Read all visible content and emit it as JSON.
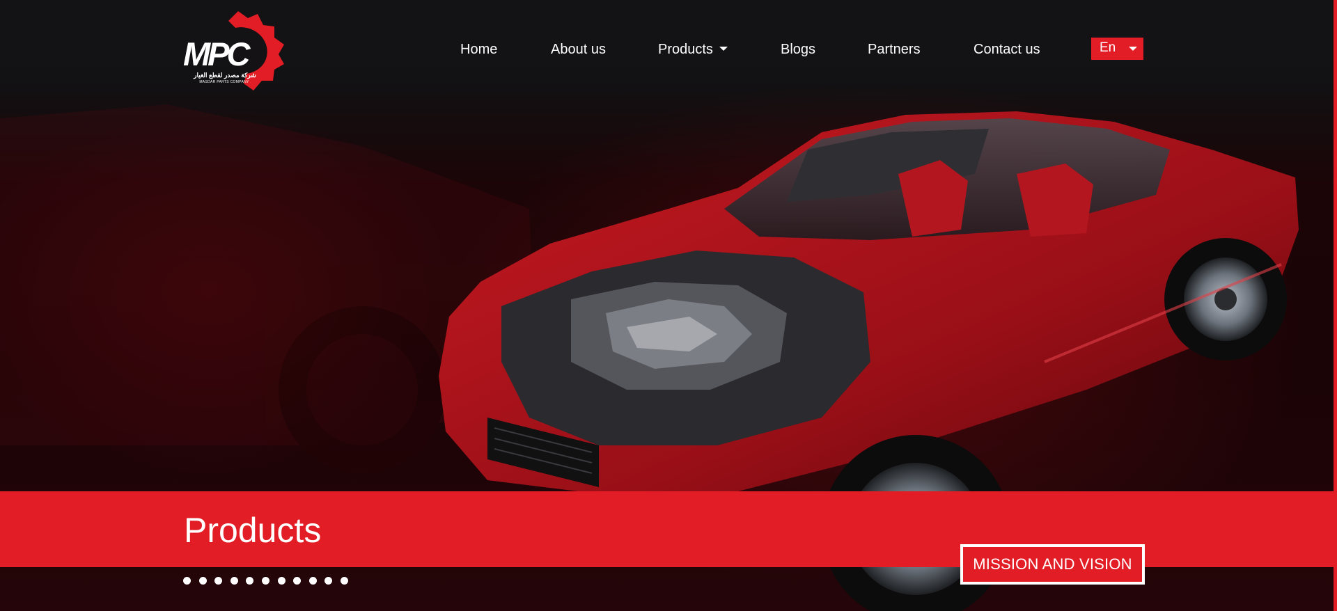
{
  "brand": {
    "logo_text": "MPC",
    "arabic_name": "شركة مصدر لقطع الغيار",
    "english_name": "MASDAR PARTS COMPANY",
    "accent_color": "#e21d26"
  },
  "nav": {
    "items": [
      {
        "label": "Home"
      },
      {
        "label": "About us"
      },
      {
        "label": "Products",
        "has_dropdown": true
      },
      {
        "label": "Blogs"
      },
      {
        "label": "Partners"
      },
      {
        "label": "Contact us"
      }
    ],
    "language": {
      "label": "En",
      "icon": "chevron-down-icon"
    }
  },
  "hero": {
    "image": "red-sports-car-cutaway",
    "band_title": "Products",
    "cta_label": "MISSION AND VISION",
    "carousel": {
      "slide_count": 11
    }
  }
}
